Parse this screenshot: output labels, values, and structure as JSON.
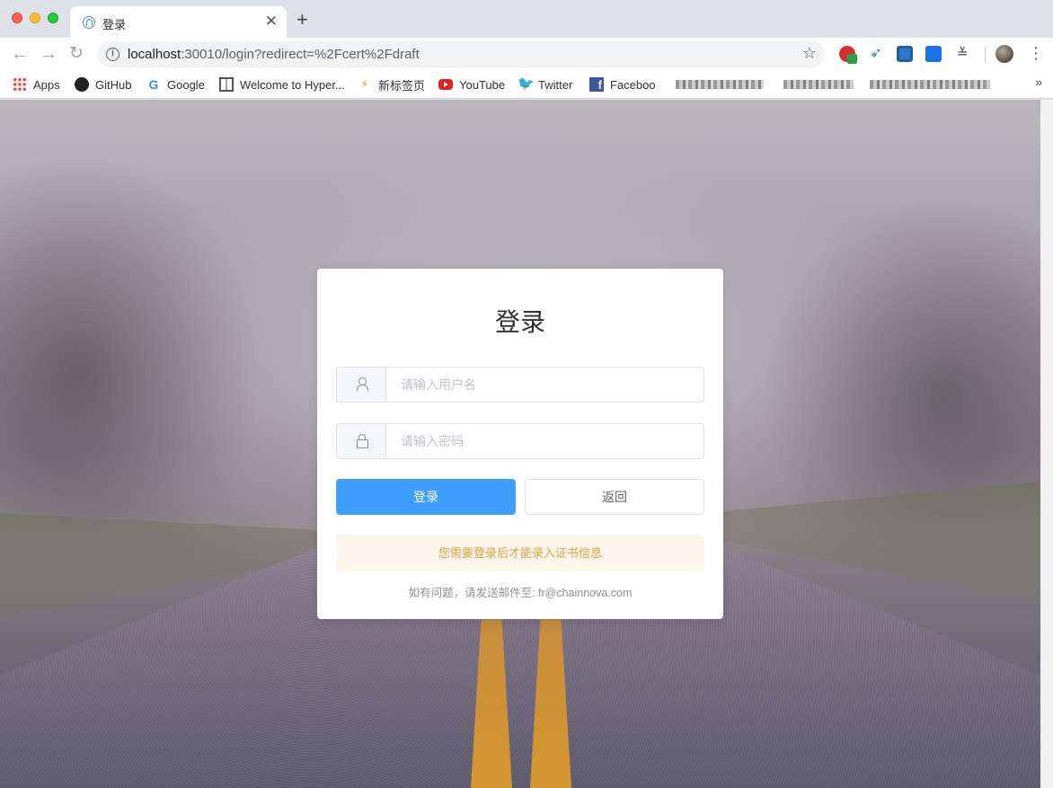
{
  "browser": {
    "tab_title": "登录",
    "url_host": "localhost",
    "url_rest": ":30010/login?redirect=%2Fcert%2Fdraft",
    "bookmarks": [
      {
        "label": "Apps"
      },
      {
        "label": "GitHub"
      },
      {
        "label": "Google"
      },
      {
        "label": "Welcome to Hyper..."
      },
      {
        "label": "新标签页"
      },
      {
        "label": "YouTube"
      },
      {
        "label": "Twitter"
      },
      {
        "label": "Faceboo"
      }
    ]
  },
  "login": {
    "title": "登录",
    "username_placeholder": "请输入用户名",
    "password_placeholder": "请输入密码",
    "login_button": "登录",
    "back_button": "返回",
    "notice": "您需要登录后才能录入证书信息",
    "contact_prefix": "如有问题，请发送邮件至: ",
    "contact_email": "fr@chainnova.com"
  },
  "colors": {
    "primary": "#409eff",
    "warning_bg": "#fdf6ec",
    "warning_text": "#e6a23c"
  }
}
